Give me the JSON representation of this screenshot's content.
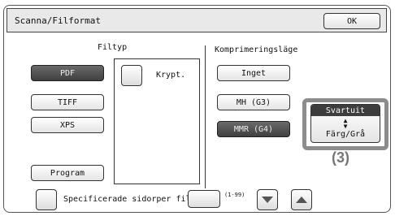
{
  "title": "Scanna/Filformat",
  "ok_label": "OK",
  "filetype": {
    "heading": "Filtyp",
    "buttons": [
      "PDF",
      "TIFF",
      "XPS"
    ],
    "program_label": "Program",
    "encrypt_label": "Krypt."
  },
  "compression": {
    "heading": "Komprimeringsläge",
    "buttons": [
      "Inget",
      "MH (G3)",
      "MMR (G4)"
    ]
  },
  "color_toggle": {
    "top": "Svartuit",
    "arrows": "▲\n▼",
    "bottom": "Färg/Grå"
  },
  "callout": "(3)",
  "pages_per_file": {
    "label": "Specificerade sidorper fil",
    "range_hint": "(1-99)"
  }
}
